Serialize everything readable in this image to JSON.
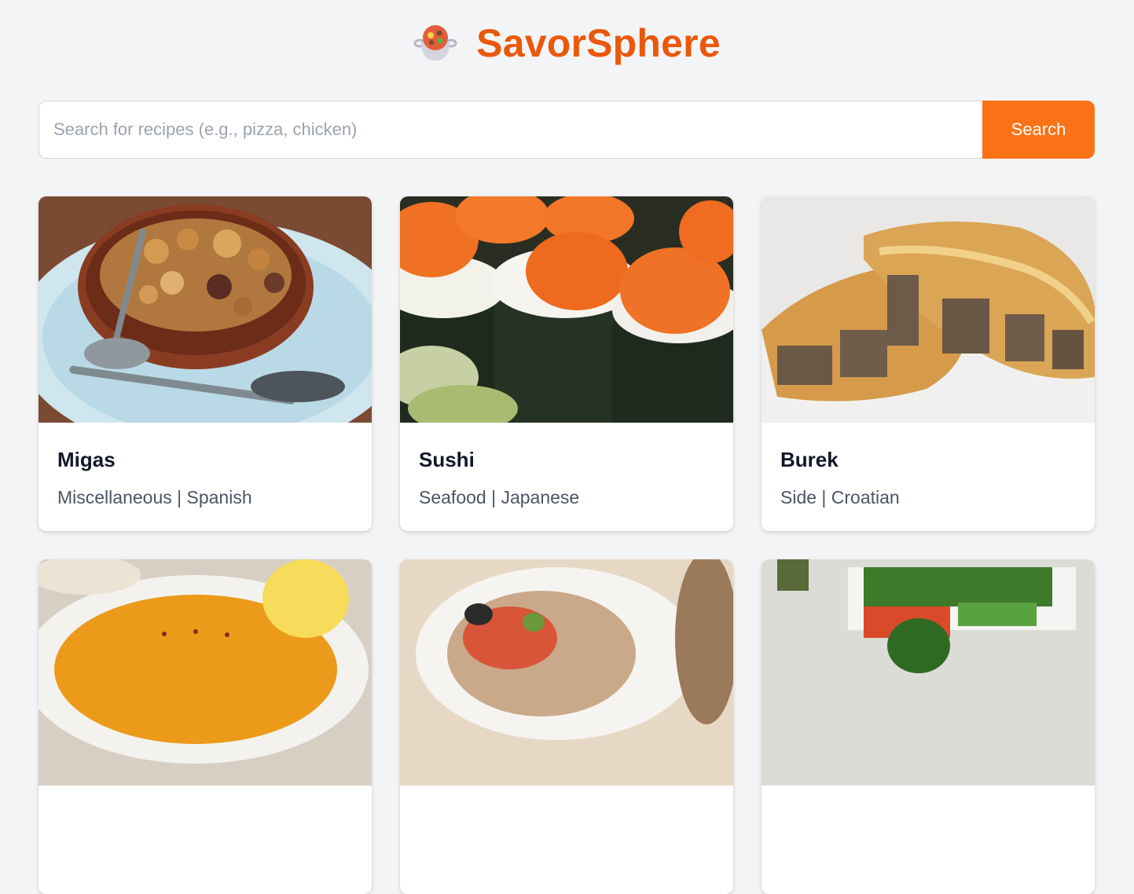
{
  "app": {
    "brand": "SavorSphere",
    "logo_icon": "cooking-pot-icon",
    "accent_color": "#ea580c",
    "button_color": "#f97316"
  },
  "search": {
    "value": "",
    "placeholder": "Search for recipes (e.g., pizza, chicken)",
    "button_label": "Search"
  },
  "recipes": [
    {
      "title": "Migas",
      "meta": "Miscellaneous | Spanish",
      "image": "migas-photo"
    },
    {
      "title": "Sushi",
      "meta": "Seafood | Japanese",
      "image": "sushi-photo"
    },
    {
      "title": "Burek",
      "meta": "Side | Croatian",
      "image": "burek-photo"
    },
    {
      "title": "",
      "meta": "",
      "image": "soup-photo"
    },
    {
      "title": "",
      "meta": "",
      "image": "stuffed-bread-photo"
    },
    {
      "title": "",
      "meta": "",
      "image": "salad-platter-photo"
    }
  ]
}
